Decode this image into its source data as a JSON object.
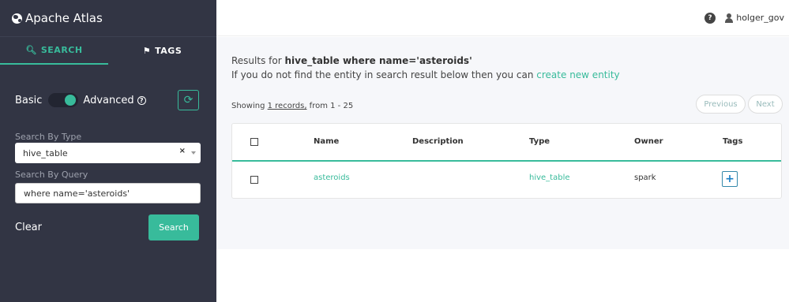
{
  "sidebar": {
    "brand": "Apache Atlas",
    "tabs": [
      {
        "label": "SEARCH",
        "icon": "search-icon"
      },
      {
        "label": "TAGS",
        "icon": "tags-icon"
      }
    ],
    "mode_basic": "Basic",
    "mode_advanced": "Advanced",
    "help_glyph": "?",
    "refresh_glyph": "⟳",
    "search_by_type_label": "Search By Type",
    "search_by_type_value": "hive_table",
    "clear_x": "×",
    "search_by_query_label": "Search By Query",
    "search_by_query_value": "where name='asteroids'",
    "clear_label": "Clear",
    "search_label": "Search"
  },
  "header": {
    "help_glyph": "?",
    "username": "holger_gov"
  },
  "main": {
    "results_prefix": "Results for ",
    "results_query": "hive_table where name='asteroids'",
    "hint_text": "If you do not find the entity in search result below then you can ",
    "create_link": "create new entity",
    "showing_prefix": "Showing ",
    "showing_records": "1 records,",
    "showing_suffix": " from 1 - 25",
    "previous_label": "Previous",
    "next_label": "Next",
    "table": {
      "headers": [
        "Name",
        "Description",
        "Type",
        "Owner",
        "Tags"
      ],
      "rows": [
        {
          "name": "asteroids",
          "description": "",
          "type": "hive_table",
          "owner": "spark",
          "tags_button": "+"
        }
      ]
    }
  },
  "colors": {
    "accent": "#38bb9b",
    "sidebar_bg": "#323544"
  }
}
